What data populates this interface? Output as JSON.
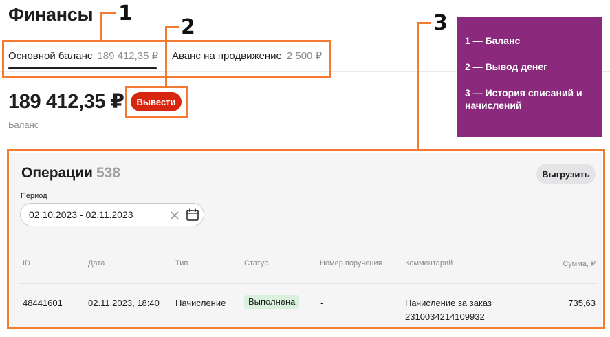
{
  "header": {
    "title": "Финансы"
  },
  "tabs": [
    {
      "label": "Основной баланс",
      "amount": "189 412,35 ₽",
      "active": true
    },
    {
      "label": "Аванс на продвижение",
      "amount": "2 500 ₽",
      "active": false
    }
  ],
  "balance": {
    "amount": "189 412,35 ₽",
    "label": "Баланс",
    "withdraw_label": "Вывести"
  },
  "operations": {
    "title": "Операции",
    "count": "538",
    "export_label": "Выгрузить",
    "period_label": "Период",
    "period_value": "02.10.2023 - 02.11.2023",
    "columns": [
      "ID",
      "Дата",
      "Тип",
      "Статус",
      "Номер поручения",
      "Комментарий",
      "Сумма, ₽"
    ],
    "rows": [
      {
        "id": "48441601",
        "date": "02.11.2023, 18:40",
        "type": "Начисление",
        "status": "Выполнена",
        "order_number": "-",
        "comment_line1": "Начисление за заказ",
        "comment_line2": "2310034214109932",
        "amount": "735,63"
      }
    ]
  },
  "annotations": {
    "numbers": [
      "1",
      "2",
      "3"
    ],
    "legend": [
      "1 — Баланс",
      "2 — Вывод денег",
      "3 — История списаний и начислений"
    ],
    "colors": {
      "frame": "#f47a30",
      "legend_bg": "#8b2a7d",
      "accent": "#d6260f",
      "status_bg": "#d9f0dc"
    }
  }
}
